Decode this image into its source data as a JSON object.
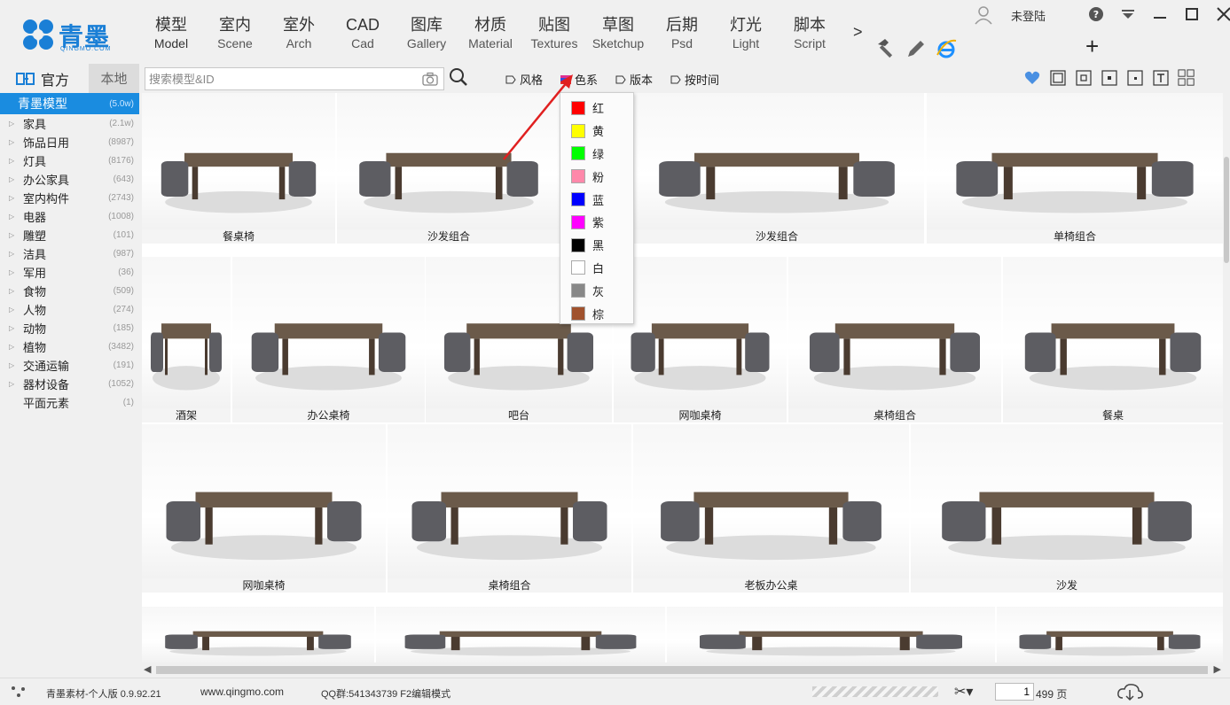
{
  "app": {
    "logo_text": "青墨",
    "logo_sub": "QINGMO.COM"
  },
  "nav": [
    {
      "cn": "模型",
      "en": "Model"
    },
    {
      "cn": "室内",
      "en": "Scene"
    },
    {
      "cn": "室外",
      "en": "Arch"
    },
    {
      "cn": "CAD",
      "en": "Cad"
    },
    {
      "cn": "图库",
      "en": "Gallery"
    },
    {
      "cn": "材质",
      "en": "Material"
    },
    {
      "cn": "贴图",
      "en": "Textures"
    },
    {
      "cn": "草图",
      "en": "Sketchup"
    },
    {
      "cn": "后期",
      "en": "Psd"
    },
    {
      "cn": "灯光",
      "en": "Light"
    },
    {
      "cn": "脚本",
      "en": "Script"
    }
  ],
  "nav_more": ">",
  "user": {
    "name": "未登陆"
  },
  "tabs": {
    "official": "官方",
    "local": "本地"
  },
  "search": {
    "placeholder": "搜索模型&ID"
  },
  "filters": {
    "style": "风格",
    "color": "色系",
    "version": "版本",
    "time": "按时间"
  },
  "categories": [
    {
      "label": "青墨模型",
      "count": "(5.0w)"
    },
    {
      "label": "家具",
      "count": "(2.1w)"
    },
    {
      "label": "饰品日用",
      "count": "(8987)"
    },
    {
      "label": "灯具",
      "count": "(8176)"
    },
    {
      "label": "办公家具",
      "count": "(643)"
    },
    {
      "label": "室内构件",
      "count": "(2743)"
    },
    {
      "label": "电器",
      "count": "(1008)"
    },
    {
      "label": "雕塑",
      "count": "(101)"
    },
    {
      "label": "洁具",
      "count": "(987)"
    },
    {
      "label": "军用",
      "count": "(36)"
    },
    {
      "label": "食物",
      "count": "(509)"
    },
    {
      "label": "人物",
      "count": "(274)"
    },
    {
      "label": "动物",
      "count": "(185)"
    },
    {
      "label": "植物",
      "count": "(3482)"
    },
    {
      "label": "交通运输",
      "count": "(191)"
    },
    {
      "label": "器材设备",
      "count": "(1052)"
    },
    {
      "label": "平面元素",
      "count": "(1)"
    }
  ],
  "tiles": [
    {
      "caption": "餐桌椅"
    },
    {
      "caption": "沙发组合"
    },
    {
      "caption": "沙发组合"
    },
    {
      "caption": "单椅组合"
    },
    {
      "caption": "酒架"
    },
    {
      "caption": "办公桌椅"
    },
    {
      "caption": "吧台"
    },
    {
      "caption": "网咖桌椅"
    },
    {
      "caption": "桌椅组合"
    },
    {
      "caption": "餐桌"
    },
    {
      "caption": "网咖桌椅"
    },
    {
      "caption": "桌椅组合"
    },
    {
      "caption": "老板办公桌"
    },
    {
      "caption": "沙发"
    },
    {
      "caption": ""
    },
    {
      "caption": ""
    },
    {
      "caption": ""
    },
    {
      "caption": ""
    },
    {
      "caption": ""
    }
  ],
  "color_menu": [
    {
      "label": "红",
      "color": "#ff0000"
    },
    {
      "label": "黄",
      "color": "#ffff00"
    },
    {
      "label": "绿",
      "color": "#00ff00"
    },
    {
      "label": "粉",
      "color": "#ff88aa"
    },
    {
      "label": "蓝",
      "color": "#0000ff"
    },
    {
      "label": "紫",
      "color": "#ff00ff"
    },
    {
      "label": "黑",
      "color": "#000000"
    },
    {
      "label": "白",
      "color": "#ffffff"
    },
    {
      "label": "灰",
      "color": "#888888"
    },
    {
      "label": "棕",
      "color": "#a0522d"
    }
  ],
  "status": {
    "version": "青墨素材-个人版 0.9.92.21",
    "url": "www.qingmo.com",
    "qq": "QQ群:541343739 F2编辑模式",
    "page": "1",
    "total": "499 页"
  },
  "accent": "#1a8ce0"
}
